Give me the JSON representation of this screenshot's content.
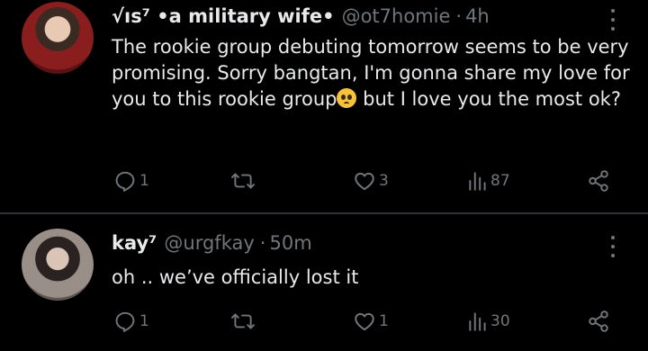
{
  "tweets": [
    {
      "display_name": "√ıs⁷ •a military wife•",
      "handle": "@ot7homie",
      "separator": "·",
      "time": "4h",
      "text_before_emoji": "The rookie group debuting tomorrow seems to be very promising. Sorry bangtan, I'm gonna share my love for you to this rookie group",
      "emoji": "pleading-face",
      "text_after_emoji": " but I love you the most ok?",
      "replies": "1",
      "retweets": "",
      "likes": "3",
      "views": "87"
    },
    {
      "display_name": "kay⁷",
      "handle": "@urgfkay",
      "separator": "·",
      "time": "50m",
      "text": "oh .. we’ve officially lost it",
      "replies": "1",
      "retweets": "",
      "likes": "1",
      "views": "30"
    }
  ],
  "icons": {
    "reply": "reply-icon",
    "retweet": "retweet-icon",
    "like": "heart-icon",
    "views": "views-icon",
    "share": "share-icon",
    "more": "more-icon"
  },
  "colors": {
    "background": "#000000",
    "text": "#e7e9ea",
    "secondary": "#71767b",
    "divider": "#2f3336"
  }
}
